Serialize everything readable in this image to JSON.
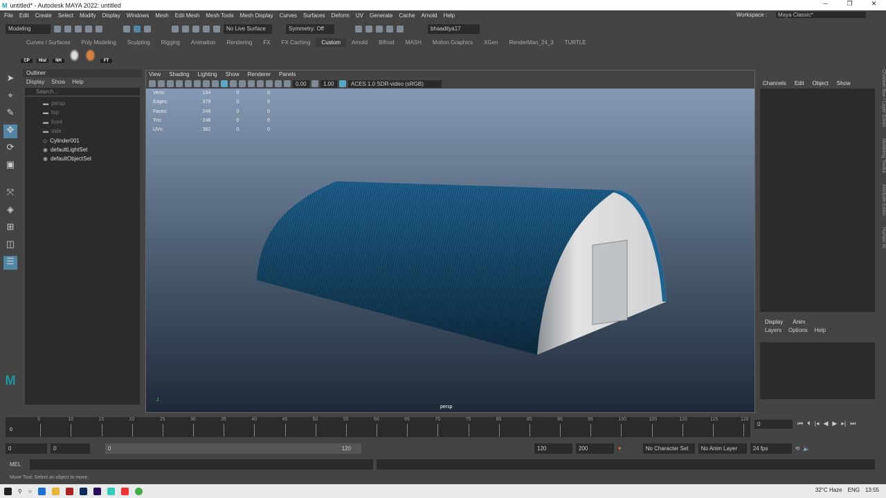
{
  "window": {
    "title": "untitled* - Autodesk MAYA 2022: untitled",
    "logo": "M",
    "controls": [
      "─",
      "❐",
      "✕"
    ]
  },
  "menu": [
    "File",
    "Edit",
    "Create",
    "Select",
    "Modify",
    "Display",
    "Windows",
    "Mesh",
    "Edit Mesh",
    "Mesh Tools",
    "Mesh Display",
    "Curves",
    "Surfaces",
    "Deform",
    "UV",
    "Generate",
    "Cache",
    "Arnold",
    "Help"
  ],
  "workspace": {
    "label": "Workspace :",
    "value": "Maya Classic*"
  },
  "toolbar": {
    "mode": "Modeling",
    "live_surface": "No Live Surface",
    "symmetry": "Symmetry: Off",
    "user": "bhaaditya17"
  },
  "shelf": {
    "tabs": [
      "Curves / Surfaces",
      "Poly Modeling",
      "Sculpting",
      "Rigging",
      "Animation",
      "Rendering",
      "FX",
      "FX Caching",
      "Custom",
      "Arnold",
      "Bifrost",
      "MASH",
      "Motion Graphics",
      "XGen",
      "RenderMan_24_3",
      "TURTLE"
    ],
    "active": "Custom",
    "icons": [
      "CP",
      "Hist",
      "NH",
      "",
      "",
      "FT"
    ]
  },
  "outliner": {
    "title": "Outliner",
    "menu": [
      "Display",
      "Show",
      "Help"
    ],
    "search_placeholder": "Search...",
    "items": [
      {
        "label": "persp",
        "dim": true
      },
      {
        "label": "top",
        "dim": true
      },
      {
        "label": "front",
        "dim": true
      },
      {
        "label": "side",
        "dim": true
      },
      {
        "label": "Cylinder001",
        "dim": false
      },
      {
        "label": "defaultLightSet",
        "dim": false
      },
      {
        "label": "defaultObjectSet",
        "dim": false
      }
    ]
  },
  "viewport": {
    "menu": [
      "View",
      "Shading",
      "Lighting",
      "Show",
      "Renderer",
      "Panels"
    ],
    "exposure": "0.00",
    "gamma": "1.00",
    "colorspace": "ACES 1.0 SDR-video (sRGB)",
    "camera": "persp",
    "hud": [
      [
        "Verts:",
        "134",
        "0",
        "0"
      ],
      [
        "Edges:",
        "379",
        "0",
        "0"
      ],
      [
        "Faces:",
        "246",
        "0",
        "0"
      ],
      [
        "Tris:",
        "246",
        "0",
        "0"
      ],
      [
        "UVs:",
        "382",
        "0",
        "0"
      ]
    ],
    "colors": {
      "roof": "#1f5f8a",
      "wall": "#d8d8d8"
    }
  },
  "channelbox": {
    "menu": [
      "Channels",
      "Edit",
      "Object",
      "Show"
    ],
    "layer_tabs": [
      "Display",
      "Anim"
    ],
    "layer_menu": [
      "Layers",
      "Options",
      "Help"
    ],
    "side_tabs": [
      "Channel Box / Layer Editor",
      "Modeling Toolkit",
      "Attribute Editor",
      "Human IK"
    ]
  },
  "timeline": {
    "ticks": [
      "5",
      "10",
      "15",
      "20",
      "25",
      "30",
      "35",
      "40",
      "45",
      "50",
      "55",
      "60",
      "65",
      "70",
      "75",
      "80",
      "85",
      "90",
      "95",
      "100",
      "105",
      "110",
      "115",
      "120"
    ],
    "current": "0",
    "current_field": "0"
  },
  "range": {
    "start": "0",
    "playback_start": "0",
    "slider_start": "0",
    "slider_end": "120",
    "playback_end": "120",
    "end": "200",
    "character_set": "No Character Set",
    "anim_layer": "No Anim Layer",
    "fps": "24 fps"
  },
  "mel": {
    "label": "MEL"
  },
  "help_line": "Move Tool: Select an object to move.",
  "taskbar": {
    "weather": "32°C  Haze",
    "lang": "ENG",
    "time": "13:55"
  }
}
